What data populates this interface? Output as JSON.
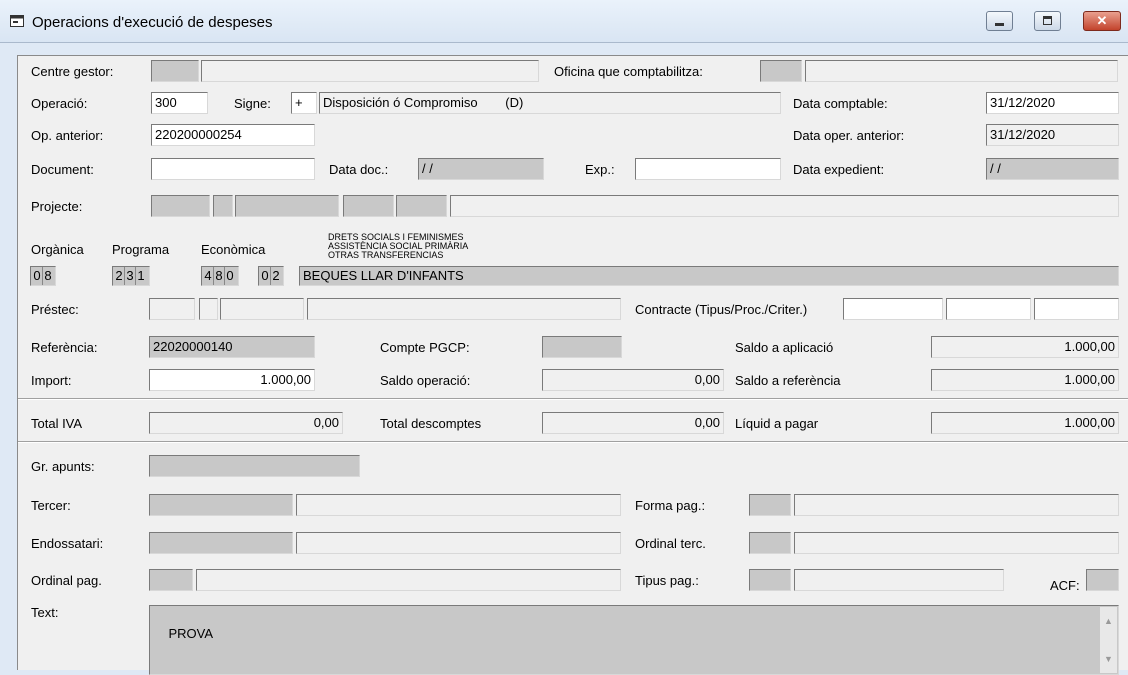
{
  "window": {
    "title": "Operacions d'execució de despeses"
  },
  "labels": {
    "centre_gestor": "Centre gestor:",
    "oficina": "Oficina que comptabilitza:",
    "operacio": "Operació:",
    "signe": "Signe:",
    "data_comptable": "Data comptable:",
    "op_anterior": "Op. anterior:",
    "data_oper_anterior": "Data oper. anterior:",
    "document": "Document:",
    "data_doc": "Data doc.:",
    "exp": "Exp.:",
    "data_expedient": "Data expedient:",
    "projecte": "Projecte:",
    "organica": "Orgànica",
    "programa": "Programa",
    "economica": "Econòmica",
    "prestec": "Préstec:",
    "contracte": "Contracte (Tipus/Proc./Criter.)",
    "referencia": "Referència:",
    "compte_pgcp": "Compte PGCP:",
    "saldo_aplicacio": "Saldo a aplicació",
    "import": "Import:",
    "saldo_operacio": "Saldo operació:",
    "saldo_referencia": "Saldo a referència",
    "total_iva": "Total IVA",
    "total_descomptes": "Total descomptes",
    "liquid_pagar": "Líquid a pagar",
    "gr_apunts": "Gr. apunts:",
    "tercer": "Tercer:",
    "forma_pag": "Forma pag.:",
    "endossatari": "Endossatari:",
    "ordinal_terc": "Ordinal terc.",
    "ordinal_pag": "Ordinal pag.",
    "tipus_pag": "Tipus pag.:",
    "acf": "ACF:",
    "text": "Text:"
  },
  "values": {
    "operacio": "300",
    "signe": "+",
    "operacio_desc": "Disposición ó Compromiso",
    "operacio_code": "(D)",
    "data_comptable": "31/12/2020",
    "op_anterior": "220200000254",
    "data_oper_anterior": "31/12/2020",
    "document": "",
    "data_doc": "/ /",
    "exp": "",
    "data_expedient": "/ /",
    "organica": [
      "0",
      "8"
    ],
    "programa": [
      "2",
      "3",
      "1"
    ],
    "economica_a": [
      "4",
      "8",
      "0"
    ],
    "economica_b": [
      "0",
      "2"
    ],
    "desc_organica": "DRETS SOCIALS I FEMINISMES",
    "desc_programa": "ASSISTÈNCIA SOCIAL PRIMÀRIA",
    "desc_economica": "OTRAS TRANSFERENCIAS",
    "partida_desc": "BEQUES LLAR D'INFANTS",
    "referencia": "22020000140",
    "saldo_aplicacio": "1.000,00",
    "import": "1.000,00",
    "saldo_operacio": "0,00",
    "saldo_referencia": "1.000,00",
    "total_iva": "0,00",
    "total_descomptes": "0,00",
    "liquid_pagar": "1.000,00",
    "text": "PROVA"
  },
  "icons": {
    "app": "form-icon",
    "minimize": "minimize-icon",
    "maximize": "maximize-icon",
    "close": "close-icon"
  }
}
